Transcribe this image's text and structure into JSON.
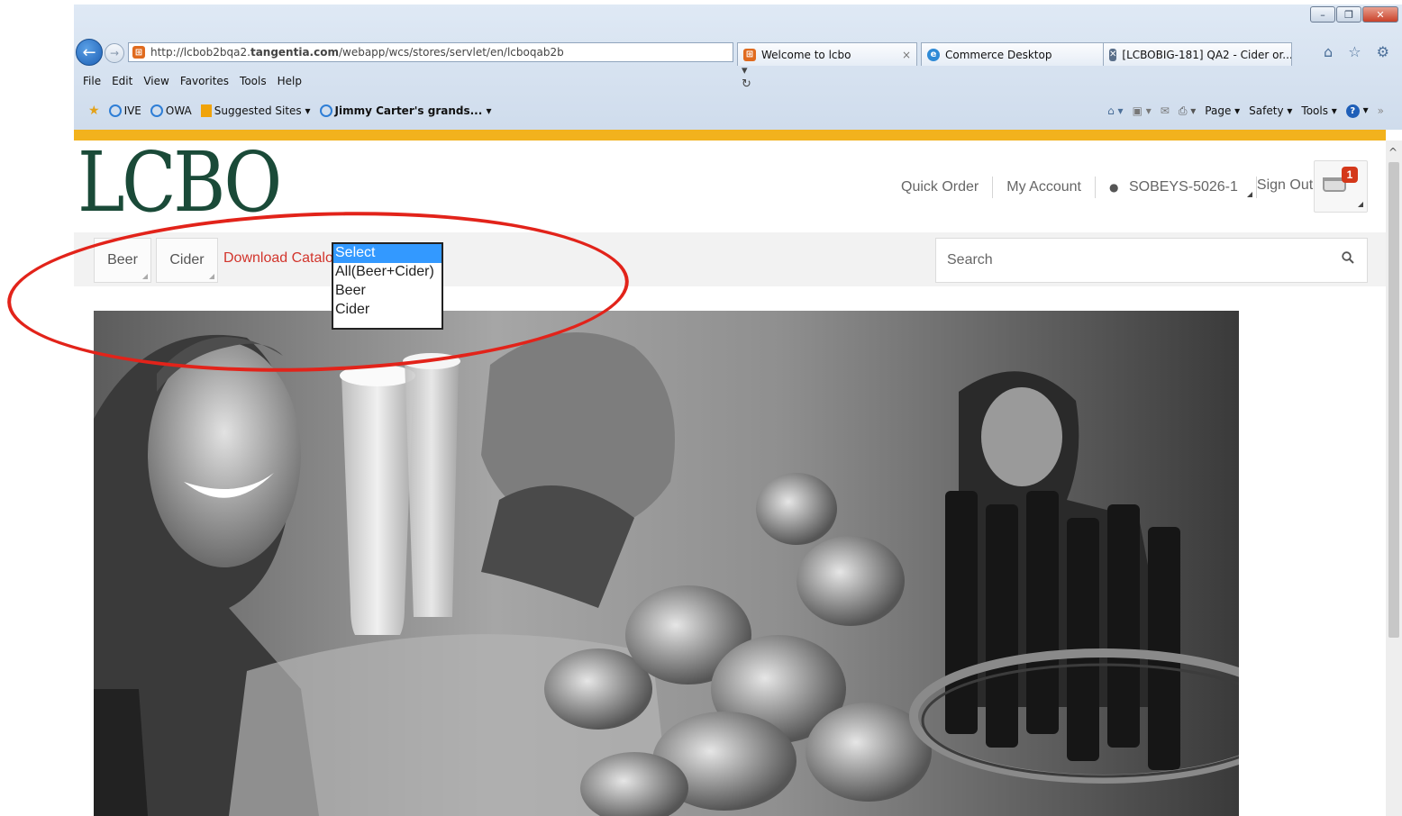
{
  "browser": {
    "address": {
      "url_prefix": "http://lcbob2bqa2.",
      "url_domain": "tangentia.com",
      "url_path": "/webapp/wcs/stores/servlet/en/lcboqab2b",
      "controls": "⌕ ▾ ↻"
    },
    "tabs": [
      {
        "label": "Welcome to lcbo",
        "close": "×"
      },
      {
        "label": "Commerce Desktop"
      },
      {
        "label": "[LCBOBIG-181] QA2 - Cider or..."
      }
    ],
    "menu": [
      "File",
      "Edit",
      "View",
      "Favorites",
      "Tools",
      "Help"
    ],
    "favorites": {
      "ive": "IVE",
      "owa": "OWA",
      "suggested": "Suggested Sites ▾",
      "jimmy": "Jimmy Carter's grands... ▾"
    },
    "commands": {
      "page": "Page ▾",
      "safety": "Safety ▾",
      "tools": "Tools ▾",
      "chevron": "»"
    },
    "window_controls": {
      "minimize": "–",
      "restore": "❐",
      "close": "✕"
    },
    "right_icons": "⌂ ☆ ⚙"
  },
  "header": {
    "logo": "LCBO",
    "quick_order": "Quick Order",
    "my_account": "My Account",
    "user": "SOBEYS-5026-1",
    "sign_out": "Sign Out",
    "cart_count": "1"
  },
  "catbar": {
    "beer": "Beer",
    "cider": "Cider",
    "download_catalog": "Download Catalog",
    "catalog_options": [
      "Select",
      "All(Beer+Cider)",
      "Beer",
      "Cider"
    ],
    "search_placeholder": "Search"
  },
  "colors": {
    "accent_gold": "#f2b21d",
    "logo_green": "#1a4a38",
    "link_red": "#d2352c",
    "annotation_red": "#e2231a",
    "dropdown_highlight": "#3399ff"
  },
  "icons": [
    "back-icon",
    "forward-icon",
    "search-icon",
    "refresh-icon",
    "home-icon",
    "star-icon",
    "gear-icon",
    "user-icon",
    "cart-icon",
    "help-icon",
    "rss-icon",
    "print-icon",
    "mail-icon"
  ]
}
